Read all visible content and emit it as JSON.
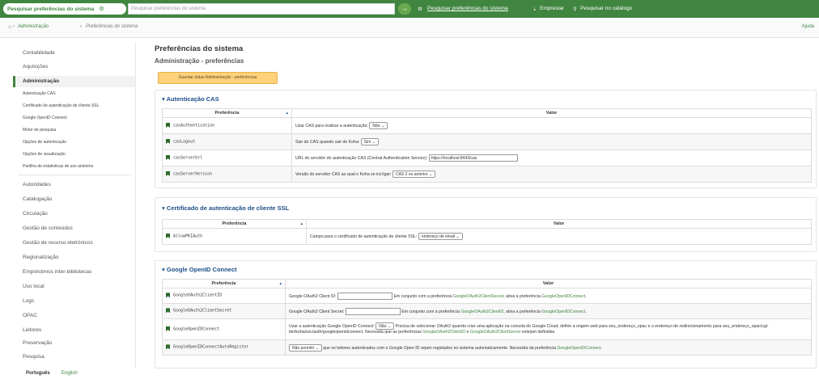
{
  "topbar": {
    "pill_label": "Pesquisar preferências do sistema",
    "search_placeholder": "Pesquisar preferências do sistema",
    "go_label": "→",
    "link_pref": "Pesquisar preferências do sistema",
    "link_emprestar": "Emprestar",
    "link_catalogo": "Pesquisar no catálogo"
  },
  "breadcrumb": {
    "home_icon": "home-icon",
    "sep": "›",
    "crumb1": "Administração",
    "crumb2": "Preferências do sistema",
    "help": "Ajuda"
  },
  "sidebar": {
    "top_items": [
      "Contabilidade",
      "Aquisições"
    ],
    "active": "Administração",
    "sub_items": [
      "Autenticação CAS",
      "Certificado de autenticação de cliente SSL",
      "Google OpenID Connect",
      "Motor de pesquisa",
      "Opções de autenticação",
      "Opções de visualização",
      "Partilha de estatísticas de uso anónimo"
    ],
    "bottom_items": [
      "Autoridades",
      "Catalogação",
      "Circulação",
      "Gestão de conteúdos",
      "Gestão de recurso eletrónicos",
      "Regionalização",
      "Empréstimos inter-bibliotecas",
      "Uso local",
      "Logs",
      "OPAC",
      "Leitores",
      "Preservação",
      "Pesquisa"
    ]
  },
  "main": {
    "title": "Preferências do sistema",
    "subtitle": "Administração - preferências",
    "save_button": "Guardar todas Administração - preferências",
    "col_pref": "Preferência",
    "col_value": "Valor",
    "sections": [
      {
        "title": "Autenticação CAS",
        "rows": [
          {
            "name": "casAuthentication",
            "text1": "Usar CAS para realizar a autenticação:",
            "select": "Não",
            "text2": ""
          },
          {
            "name": "casLogout",
            "text1": "Sair do CAS quando sair do Koha:",
            "select": "Sim",
            "text2": ""
          },
          {
            "name": "casServerUrl",
            "text1": "URL do servidor do autenticação CAS (Central Authentication Service):",
            "input": "https://localhost:8443/cas",
            "text2": ""
          },
          {
            "name": "casServerVersion",
            "text1": "Versão do servidor CAS ao qual o Koha se irá ligar:",
            "select": "CAS 2 ou anterior",
            "text2": ""
          }
        ]
      },
      {
        "title": "Certificado de autenticação de cliente SSL",
        "rows": [
          {
            "name": "AllowPKIAuth",
            "text1": "Campo para o certificado de autenticação de cliente SSL:",
            "select": "endereço de email",
            "text2": ""
          }
        ]
      },
      {
        "title": "Google OpenID Connect",
        "rows": [
          {
            "name": "GoogleOAuth2ClientID",
            "text1": "Google OAuth2 Client ID:",
            "input": "",
            "text2": "Em conjunto com a preferência",
            "link1": "GoogleOAuth2ClientSecret",
            "text3": ", ativa a preferência",
            "link2": "GoogleOpenIDConnect",
            "text4": "."
          },
          {
            "name": "GoogleOAuth2ClientSecret",
            "text1": "Google OAuth2 Client Secret:",
            "input": "",
            "text2": "Em conjunto com a preferência",
            "link1": "GoogleOAuth2ClientID",
            "text3": ", ativa a preferência",
            "link2": "GoogleOpenIDConnect",
            "text4": "."
          },
          {
            "name": "GoogleOpenIDConnect",
            "text1": "Usar a autenticação Google OpenID Connect:",
            "select": "Não",
            "text2": "Precisa de selecionar OAuth2 quando criar uma aplicação na consola do Google Cloud, definir a origem web para seu_endereço_opac e o endereço de redirecionamento para seu_endereço_opac/cgi-bin/koha/svc/auth/googleopenidconnect. Necessita que as preferências",
            "link1": "GoogleOAuth2ClientID",
            "text3": "e",
            "link2": "GoogleOAuth2ClientSecret",
            "text4": "estejam definidas."
          },
          {
            "name": "GoogleOpenIDConnectAutoRegister",
            "text1": "",
            "select": "Não permitir",
            "text2": "que os leitores autenticados com o Google Open ID sejam registados no sistema automaticamente. Necessita da preferência",
            "link1": "GoogleOpenIDConnect",
            "text3": ".",
            "link2": "",
            "text4": ""
          }
        ]
      }
    ]
  },
  "footer": {
    "lang_current": "Português",
    "lang_other": "English"
  },
  "colors": {
    "brand_green": "#408540",
    "section_blue": "#1d4e89",
    "save_yellow": "#fed17a"
  }
}
